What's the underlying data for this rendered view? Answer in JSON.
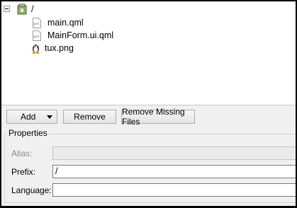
{
  "tree": {
    "root": {
      "label": "/",
      "expanded": true
    },
    "files": [
      {
        "label": "main.qml",
        "icon": "qml-file-icon"
      },
      {
        "label": "MainForm.ui.qml",
        "icon": "qml-file-icon"
      },
      {
        "label": "tux.png",
        "icon": "tux-image-icon"
      }
    ]
  },
  "toolbar": {
    "add_label": "Add",
    "remove_label": "Remove",
    "remove_missing_label": "Remove Missing Files"
  },
  "properties": {
    "title": "Properties",
    "alias_label": "Alias:",
    "alias_value": "",
    "prefix_label": "Prefix:",
    "prefix_value": "/",
    "language_label": "Language:",
    "language_value": ""
  }
}
